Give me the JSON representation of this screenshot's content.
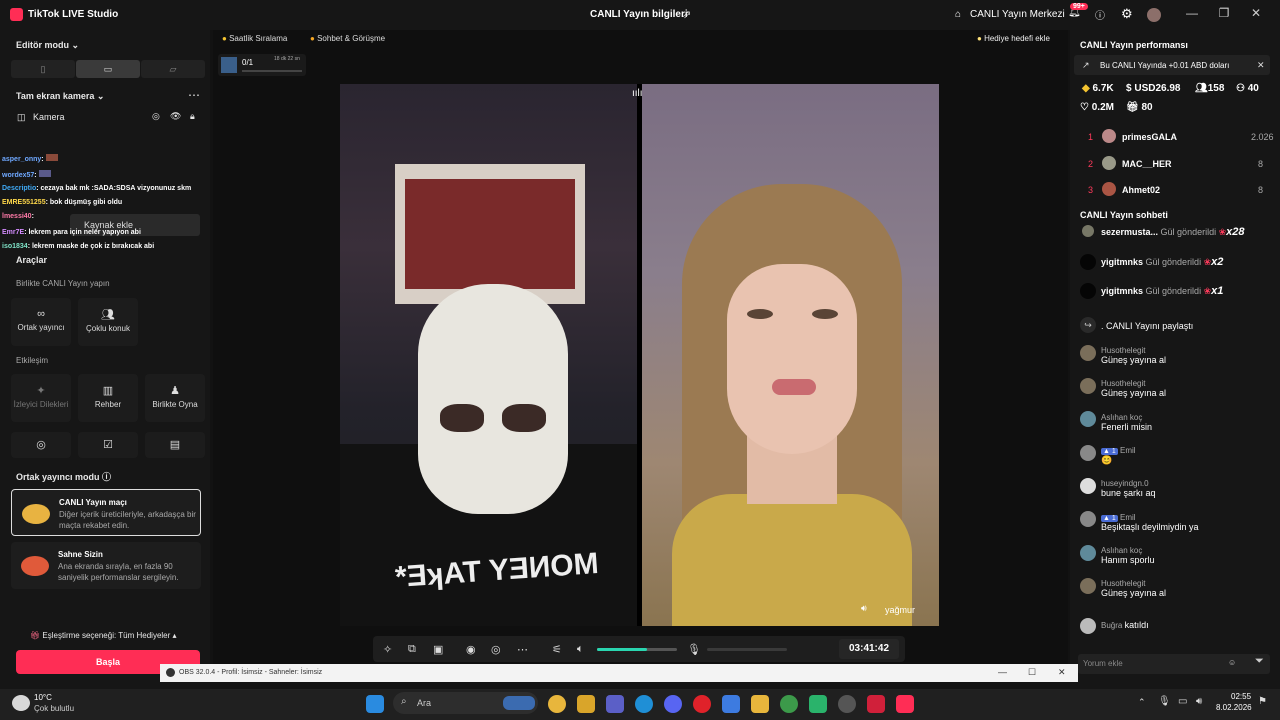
{
  "titlebar": {
    "app_title": "TikTok LIVE Studio",
    "center_title": "CANLI Yayın bilgileri",
    "live_center": "CANLI Yayın Merkezi",
    "notif_badge": "99+"
  },
  "left": {
    "editor_mode": "Editör modu",
    "scene_label": "Tam ekran kamera",
    "camera_label": "Kamera",
    "add_source": "Kaynak ekle",
    "chat_overlay": [
      {
        "user": "asper_onny",
        "text": ":"
      },
      {
        "user": "wordex57",
        "text": ":"
      },
      {
        "user": "Descriptio",
        "text": ": cezaya bak mk :SADA:SDSA vizyonunuz skm"
      },
      {
        "user": "EMRE551255",
        "text": ": bok düşmüş gibi oldu"
      },
      {
        "user": "lmessi40",
        "text": ":"
      },
      {
        "user": "Emr7E",
        "text": ": lekrem para için neler yapıyon abi"
      },
      {
        "user": "iso1834",
        "text": ": lekrem maske de çok iz bırakıcak abi"
      }
    ],
    "tools_title": "Araçlar",
    "together_title": "Birlikte CANLI Yayın yapın",
    "tools_together": [
      "Ortak yayıncı",
      "Çoklu konuk"
    ],
    "interaction_title": "Etkileşim",
    "tools_interaction": [
      "İzleyici Dilekleri",
      "Rehber",
      "Birlikte Oyna"
    ],
    "cohost_title": "Ortak yayıncı modu",
    "cards": [
      {
        "title": "CANLI Yayın maçı",
        "desc": "Diğer içerik üreticileriyle, arkadaşça bir maçta rekabet edin."
      },
      {
        "title": "Sahne Sizin",
        "desc": "Ana ekranda sırayla, en fazla 90 saniyelik performanslar sergileyin."
      }
    ],
    "match_option": "Eşleştirme seçeneği: Tüm Hediyeler",
    "start_button": "Başla"
  },
  "center": {
    "pill_ranking": "Saatlik Sıralama",
    "pill_chat": "Sohbet & Görüşme",
    "goal_add": "Hediye hedefi ekle",
    "goal_count": "0/1",
    "goal_timer": "18 dk 22 sn",
    "shirt_text": "*ƎʞAT YƎИOM",
    "caption": "yağmur",
    "timer": "03:41:42",
    "volume_level": 0.62
  },
  "right": {
    "performance_title": "CANLI Yayın performansı",
    "banner": "Bu CANLI Yayında +0.01 ABD doları",
    "stats": {
      "diamonds": "6.7K",
      "usd": "USD26.98",
      "viewers": "158",
      "shares": "40",
      "likes": "0.2M",
      "gifts": "80"
    },
    "ranking": [
      {
        "rank": "1",
        "user": "primesGALA",
        "value": "2.026"
      },
      {
        "rank": "2",
        "user": "MAC__HER",
        "value": "8"
      },
      {
        "rank": "3",
        "user": "Ahmet02",
        "value": "8"
      }
    ],
    "chat_title": "CANLI Yayın sohbeti",
    "gifts": [
      {
        "user": "sezermusta...",
        "action": "Gül gönderildi",
        "count": "x28"
      },
      {
        "user": "yigitmnks",
        "action": "Gül gönderildi",
        "count": "x2"
      },
      {
        "user": "yigitmnks",
        "action": "Gül gönderildi",
        "count": "x1"
      }
    ],
    "share_text": "CANLI Yayını paylaştı",
    "comments": [
      {
        "user": "Husothelegit",
        "text": "Güneş yayına al"
      },
      {
        "user": "Husothelegit",
        "text": "Güneş yayına al"
      },
      {
        "user": "Aslıhan koç",
        "text": "Fenerli misin"
      },
      {
        "user": "Emil",
        "text": "😊"
      },
      {
        "user": "huseyindgn.0",
        "text": "bune şarkı aq"
      },
      {
        "user": "Emil",
        "text": "Beşiktaşlı deyilmiydin ya"
      },
      {
        "user": "Aslıhan koç",
        "text": "Hanım sporlu"
      },
      {
        "user": "Husothelegit",
        "text": "Güneş yayına al"
      }
    ],
    "join_user": "Buğra",
    "join_text": "katıldı",
    "comment_placeholder": "Yorum ekle"
  },
  "obs": {
    "title": "OBS 32.0.4 - Profil: İsimsiz - Sahneler: İsimsiz"
  },
  "taskbar": {
    "weather_temp": "10°C",
    "weather_desc": "Çok bulutlu",
    "search": "Ara",
    "time": "02:55",
    "date": "8.02.2026"
  },
  "colors": {
    "accent": "#ff2d55",
    "bg": "#121212",
    "panel": "#161616"
  }
}
